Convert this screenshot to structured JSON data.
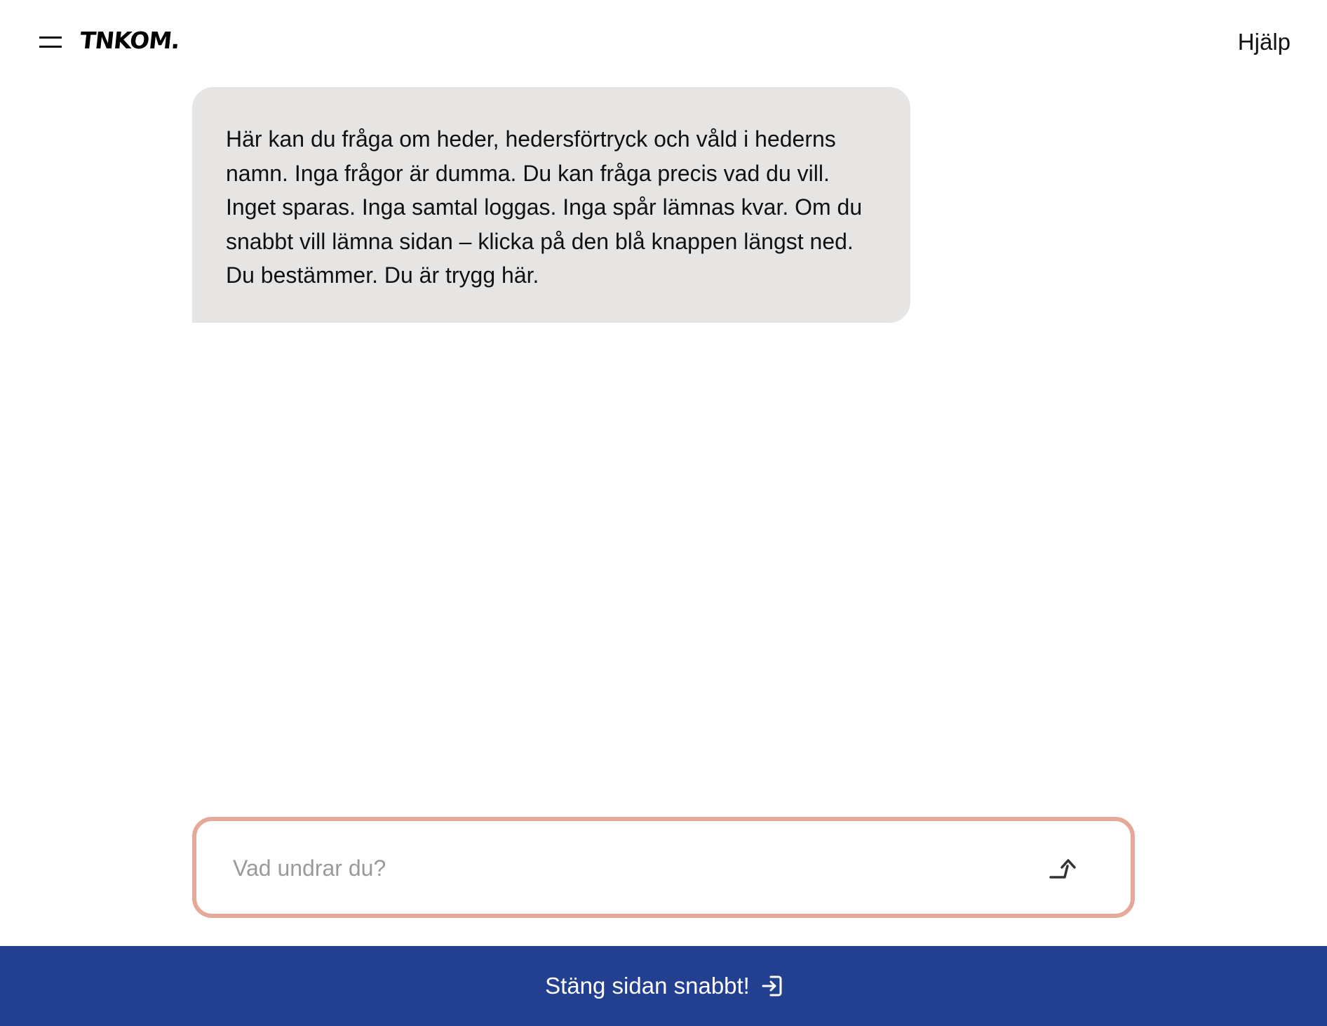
{
  "header": {
    "logo_text": "TNKOM.",
    "menu_icon": "hamburger-icon",
    "help_label": "Hjälp"
  },
  "chat": {
    "messages": [
      {
        "role": "assistant",
        "text": "Här kan du fråga om heder, hedersförtryck och våld i hederns namn. Inga frågor är dumma. Du kan fråga precis vad du vill. Inget sparas. Inga samtal loggas. Inga spår lämnas kvar. Om du snabbt vill lämna sidan – klicka på den blå knappen längst ned. Du bestämmer. Du är trygg här."
      }
    ],
    "input": {
      "placeholder": "Vad undrar du?",
      "value": "",
      "send_icon": "send-arrow-icon"
    }
  },
  "footer": {
    "exit_label": "Stäng sidan snabbt!",
    "exit_icon": "exit-icon"
  },
  "colors": {
    "bubble_bg": "#e6e5e3",
    "input_border": "#e5a99a",
    "exit_bar_bg": "#22408f",
    "placeholder": "#9a9a9a"
  }
}
